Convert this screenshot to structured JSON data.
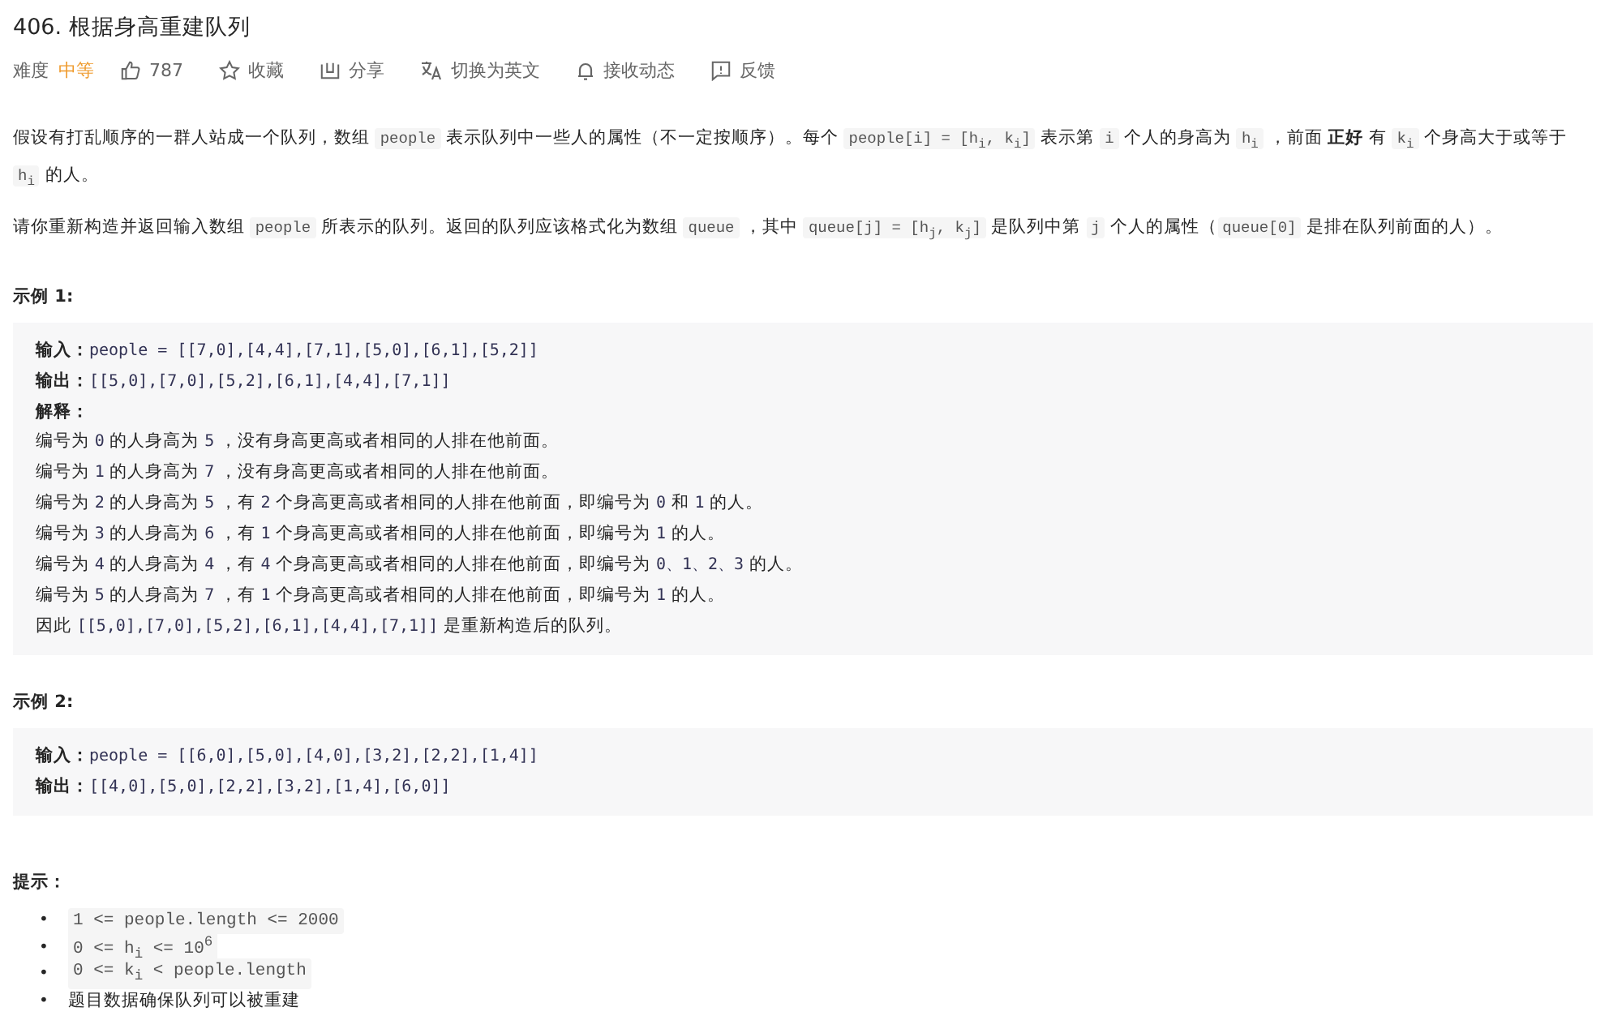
{
  "title": "406. 根据身高重建队列",
  "toolbar": {
    "difficulty_label": "难度",
    "difficulty": "中等",
    "actions": [
      {
        "kind": "like",
        "label": "787"
      },
      {
        "kind": "star",
        "label": "收藏"
      },
      {
        "kind": "share",
        "label": "分享"
      },
      {
        "kind": "translate",
        "label": "切换为英文"
      },
      {
        "kind": "bell",
        "label": "接收动态"
      },
      {
        "kind": "feedback",
        "label": "反馈"
      }
    ]
  },
  "description": [
    [
      {
        "kind": "text",
        "t": "假设有打乱顺序的一群人站成一个队列，数组 "
      },
      {
        "kind": "code",
        "t": "people"
      },
      {
        "kind": "text",
        "t": " 表示队列中一些人的属性（不一定按顺序）。每个 "
      },
      {
        "kind": "code",
        "t": "people[i] = [h$_{i}$, k$_{i}$]"
      },
      {
        "kind": "text",
        "t": " 表示第 "
      },
      {
        "kind": "code",
        "t": "i"
      },
      {
        "kind": "text",
        "t": " 个人的身高为 "
      },
      {
        "kind": "code",
        "t": "h$_{i}$"
      },
      {
        "kind": "text",
        "t": " ，前面 **正好** 有 "
      },
      {
        "kind": "code",
        "t": "k$_{i}$"
      },
      {
        "kind": "text",
        "t": " 个身高大于或等于 "
      },
      {
        "kind": "code",
        "t": "h$_{i}$"
      },
      {
        "kind": "text",
        "t": " 的人。"
      }
    ],
    [
      {
        "kind": "text",
        "t": "请你重新构造并返回输入数组 "
      },
      {
        "kind": "code",
        "t": "people"
      },
      {
        "kind": "text",
        "t": " 所表示的队列。返回的队列应该格式化为数组 "
      },
      {
        "kind": "code",
        "t": "queue"
      },
      {
        "kind": "text",
        "t": " ，其中 "
      },
      {
        "kind": "code",
        "t": "queue[j] = [h$_{j}$, k$_{j}$]"
      },
      {
        "kind": "text",
        "t": " 是队列中第 "
      },
      {
        "kind": "code",
        "t": "j"
      },
      {
        "kind": "text",
        "t": " 个人的属性（"
      },
      {
        "kind": "code",
        "t": "queue[0]"
      },
      {
        "kind": "text",
        "t": " 是排在队列前面的人）。"
      }
    ]
  ],
  "examples": [
    {
      "heading": "示例 1:",
      "lines": [
        [
          {
            "kind": "label",
            "t": "输入："
          },
          {
            "kind": "code",
            "t": "people = [[7,0],[4,4],[7,1],[5,0],[6,1],[5,2]]"
          }
        ],
        [
          {
            "kind": "label",
            "t": "输出："
          },
          {
            "kind": "code",
            "t": "[[5,0],[7,0],[5,2],[6,1],[4,4],[7,1]]"
          }
        ],
        [
          {
            "kind": "label",
            "t": "解释："
          }
        ],
        [
          {
            "kind": "text",
            "t": "编号为 "
          },
          {
            "kind": "code",
            "t": "0"
          },
          {
            "kind": "text",
            "t": " 的人身高为 "
          },
          {
            "kind": "code",
            "t": "5"
          },
          {
            "kind": "text",
            "t": " ，没有身高更高或者相同的人排在他前面。"
          }
        ],
        [
          {
            "kind": "text",
            "t": "编号为 "
          },
          {
            "kind": "code",
            "t": "1"
          },
          {
            "kind": "text",
            "t": " 的人身高为 "
          },
          {
            "kind": "code",
            "t": "7"
          },
          {
            "kind": "text",
            "t": " ，没有身高更高或者相同的人排在他前面。"
          }
        ],
        [
          {
            "kind": "text",
            "t": "编号为 "
          },
          {
            "kind": "code",
            "t": "2"
          },
          {
            "kind": "text",
            "t": " 的人身高为 "
          },
          {
            "kind": "code",
            "t": "5"
          },
          {
            "kind": "text",
            "t": " ，有 "
          },
          {
            "kind": "code",
            "t": "2"
          },
          {
            "kind": "text",
            "t": " 个身高更高或者相同的人排在他前面，即编号为 "
          },
          {
            "kind": "code",
            "t": "0"
          },
          {
            "kind": "text",
            "t": " 和 "
          },
          {
            "kind": "code",
            "t": "1"
          },
          {
            "kind": "text",
            "t": " 的人。"
          }
        ],
        [
          {
            "kind": "text",
            "t": "编号为 "
          },
          {
            "kind": "code",
            "t": "3"
          },
          {
            "kind": "text",
            "t": " 的人身高为 "
          },
          {
            "kind": "code",
            "t": "6"
          },
          {
            "kind": "text",
            "t": " ，有 "
          },
          {
            "kind": "code",
            "t": "1"
          },
          {
            "kind": "text",
            "t": " 个身高更高或者相同的人排在他前面，即编号为 "
          },
          {
            "kind": "code",
            "t": "1"
          },
          {
            "kind": "text",
            "t": " 的人。"
          }
        ],
        [
          {
            "kind": "text",
            "t": "编号为 "
          },
          {
            "kind": "code",
            "t": "4"
          },
          {
            "kind": "text",
            "t": " 的人身高为 "
          },
          {
            "kind": "code",
            "t": "4"
          },
          {
            "kind": "text",
            "t": " ，有 "
          },
          {
            "kind": "code",
            "t": "4"
          },
          {
            "kind": "text",
            "t": " 个身高更高或者相同的人排在他前面，即编号为 "
          },
          {
            "kind": "code",
            "t": "0、1、2、3"
          },
          {
            "kind": "text",
            "t": " 的人。"
          }
        ],
        [
          {
            "kind": "text",
            "t": "编号为 "
          },
          {
            "kind": "code",
            "t": "5"
          },
          {
            "kind": "text",
            "t": " 的人身高为 "
          },
          {
            "kind": "code",
            "t": "7"
          },
          {
            "kind": "text",
            "t": " ，有 "
          },
          {
            "kind": "code",
            "t": "1"
          },
          {
            "kind": "text",
            "t": " 个身高更高或者相同的人排在他前面，即编号为 "
          },
          {
            "kind": "code",
            "t": "1"
          },
          {
            "kind": "text",
            "t": " 的人。"
          }
        ],
        [
          {
            "kind": "text",
            "t": "因此 "
          },
          {
            "kind": "code",
            "t": "[[5,0],[7,0],[5,2],[6,1],[4,4],[7,1]]"
          },
          {
            "kind": "text",
            "t": " 是重新构造后的队列。"
          }
        ]
      ]
    },
    {
      "heading": "示例 2:",
      "lines": [
        [
          {
            "kind": "label",
            "t": "输入："
          },
          {
            "kind": "code",
            "t": "people = [[6,0],[5,0],[4,0],[3,2],[2,2],[1,4]]"
          }
        ],
        [
          {
            "kind": "label",
            "t": "输出："
          },
          {
            "kind": "code",
            "t": "[[4,0],[5,0],[2,2],[3,2],[1,4],[6,0]]"
          }
        ]
      ]
    }
  ],
  "hints": {
    "heading": "提示：",
    "marker": "•",
    "items": [
      {
        "kind": "code",
        "t": "1 <= people.length <= 2000"
      },
      {
        "kind": "code",
        "t": "0 <= h$_{i}$ <= 10$^{6}$"
      },
      {
        "kind": "code",
        "t": "0 <= k$_{i}$ < people.length"
      },
      {
        "kind": "text",
        "t": "题目数据确保队列可以被重建"
      }
    ]
  }
}
